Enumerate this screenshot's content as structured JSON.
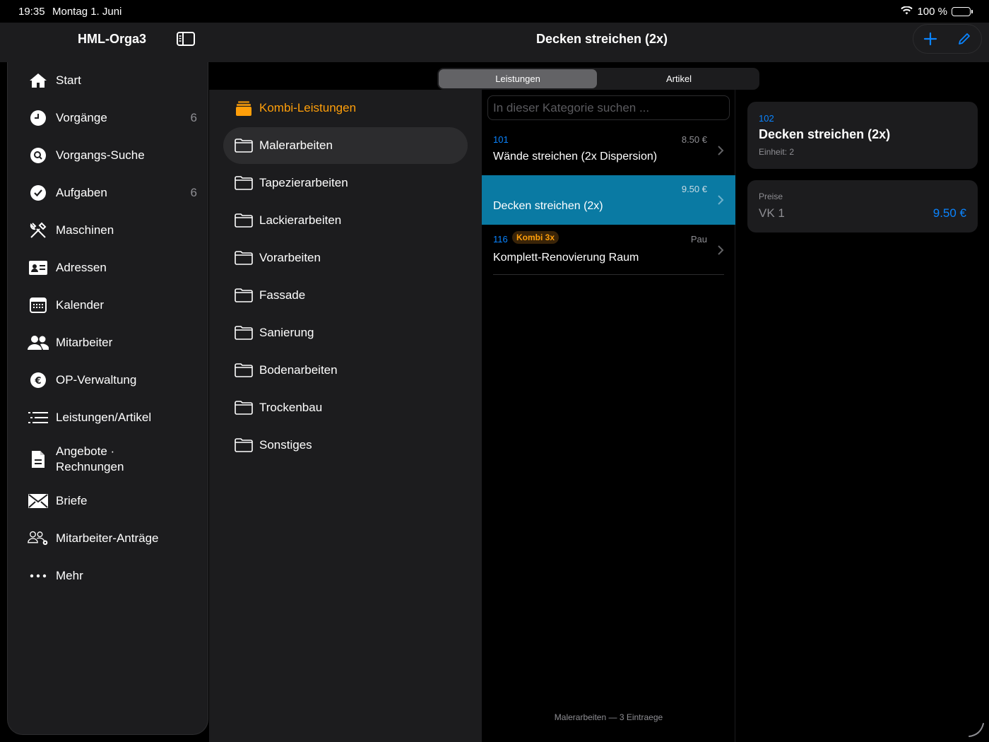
{
  "status": {
    "time": "19:35",
    "date": "Montag 1. Juni",
    "battery": "100 %"
  },
  "nav": {
    "app_title": "HML-Orga3",
    "page_title": "Decken streichen (2x)"
  },
  "sidebar": {
    "items": [
      {
        "label": "Start",
        "icon": "house-icon"
      },
      {
        "label": "Vorgänge",
        "icon": "clock-icon",
        "badge": "6"
      },
      {
        "label": "Vorgangs-Suche",
        "icon": "search-icon"
      },
      {
        "label": "Aufgaben",
        "icon": "checkmark-icon",
        "badge": "6"
      },
      {
        "label": "Maschinen",
        "icon": "tools-icon"
      },
      {
        "label": "Adressen",
        "icon": "contact-card-icon"
      },
      {
        "label": "Kalender",
        "icon": "calendar-icon"
      },
      {
        "label": "Mitarbeiter",
        "icon": "people-icon"
      },
      {
        "label": "OP-Verwaltung",
        "icon": "euro-icon"
      },
      {
        "label": "Leistungen/Artikel",
        "icon": "list-icon"
      },
      {
        "label": "Angebote ·",
        "label2": "Rechnungen",
        "icon": "document-icon"
      },
      {
        "label": "Briefe",
        "icon": "envelope-icon"
      },
      {
        "label": "Mitarbeiter-Anträge",
        "icon": "people-gear-icon"
      },
      {
        "label": "Mehr",
        "icon": "more-icon"
      }
    ]
  },
  "segments": {
    "active": "Leistungen",
    "inactive": "Artikel"
  },
  "categories": [
    {
      "label": "Kombi-Leistungen",
      "icon": "kombi-stack-icon"
    },
    {
      "label": "Malerarbeiten",
      "icon": "folder-icon"
    },
    {
      "label": "Tapezierarbeiten",
      "icon": "folder-icon"
    },
    {
      "label": "Lackierarbeiten",
      "icon": "folder-icon"
    },
    {
      "label": "Vorarbeiten",
      "icon": "folder-icon"
    },
    {
      "label": "Fassade",
      "icon": "folder-icon"
    },
    {
      "label": "Sanierung",
      "icon": "folder-icon"
    },
    {
      "label": "Bodenarbeiten",
      "icon": "folder-icon"
    },
    {
      "label": "Trockenbau",
      "icon": "folder-icon"
    },
    {
      "label": "Sonstiges",
      "icon": "folder-icon"
    }
  ],
  "list": {
    "search_placeholder": "In dieser Kategorie suchen ...",
    "rows": [
      {
        "num": "101",
        "name": "Wände streichen (2x Dispersion)",
        "price": "8.50 €"
      },
      {
        "num": "",
        "name": "Decken streichen (2x)",
        "price": "9.50 €"
      },
      {
        "num": "116",
        "badge": "Kombi 3x",
        "name": "Komplett-Renovierung Raum",
        "price": "Pau"
      }
    ],
    "footer": "Malerarbeiten — 3 Eintraege"
  },
  "detail": {
    "num": "102",
    "title": "Decken streichen (2x)",
    "unit": "Einheit: 2",
    "prices_label": "Preise",
    "vk_label": "VK 1",
    "vk_value": "9.50 €"
  },
  "colors": {
    "accent": "#0a84ff",
    "selected_row": "#0a7aa3",
    "kombi": "#ff9f0a",
    "panel": "#1c1c1e"
  }
}
